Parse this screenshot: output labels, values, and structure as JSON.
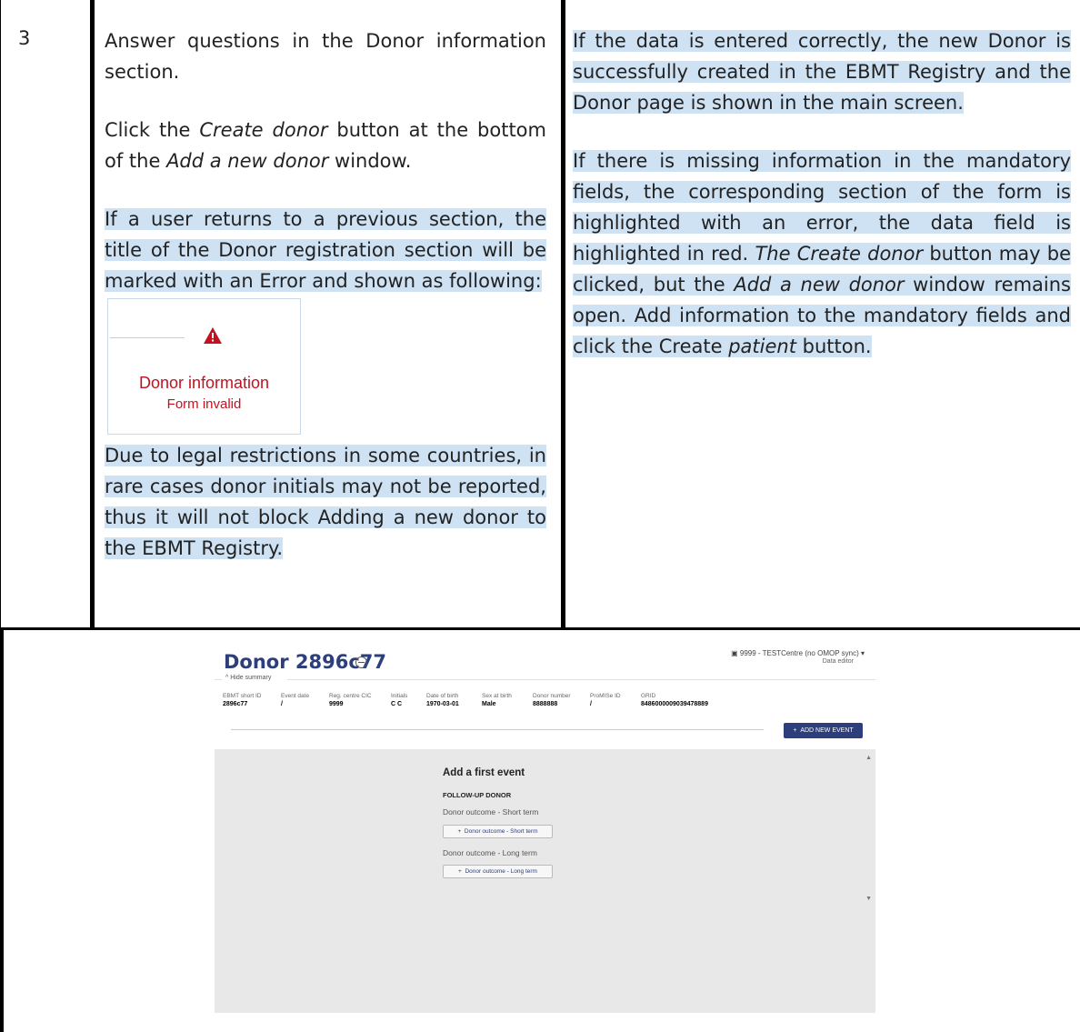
{
  "step": {
    "number": "3"
  },
  "instructions": {
    "p1": "Answer questions in the Donor information section.",
    "p2_before": "Click the ",
    "p2_em1": "Create donor",
    "p2_mid": " button at the bottom of the ",
    "p2_em2": "Add a new donor",
    "p2_after": " window.",
    "p3": "If a user returns to a previous section, the title of the Donor registration section will be marked with an Error and shown as following:",
    "error_image": {
      "title": "Donor information",
      "subtitle": "Form invalid",
      "color": "#c1121f"
    },
    "p4": "Due to legal restrictions in some countries, in rare cases donor initials may not be reported, thus it will not block Adding a new donor to the EBMT Registry."
  },
  "results": {
    "p1": "If the data is entered correctly, the new Donor is successfully created in the EBMT Registry and the Donor page is shown in the main screen.",
    "p2_a": "If there is missing information in the mandatory fields, the corresponding section of the form is highlighted with an error, the data field is highlighted in red. ",
    "p2_em1": "The Create donor",
    "p2_b": " button may be clicked, but the ",
    "p2_em2": "Add a new donor",
    "p2_c": " window remains open. Add information to the mandatory fields and click the Create ",
    "p2_em3": "patient",
    "p2_d": " button."
  },
  "screenshot": {
    "title": "Donor 2896c77",
    "centre": "9999 - TESTCentre (no OMOP sync)",
    "role": "Data editor",
    "hide_summary": "Hide summary",
    "summary_headers": [
      "EBMT short ID",
      "Event date",
      "Reg. centre CIC",
      "Initials",
      "Date of birth",
      "Sex at birth",
      "Donor number",
      "ProMISe ID",
      "GRID"
    ],
    "summary_values": [
      "2896c77",
      "/",
      "9999",
      "C C",
      "1970-03-01",
      "Male",
      "8888888",
      "/",
      "8486000009039478889"
    ],
    "add_new_event": "ADD NEW EVENT",
    "add_first_event": "Add a first event",
    "follow_up_donor": "FOLLOW-UP DONOR",
    "short_term_label": "Donor outcome - Short term",
    "short_term_button": "Donor outcome - Short term",
    "long_term_label": "Donor outcome - Long term",
    "long_term_button": "Donor outcome - Long term",
    "accent_color": "#2c3e7b"
  }
}
